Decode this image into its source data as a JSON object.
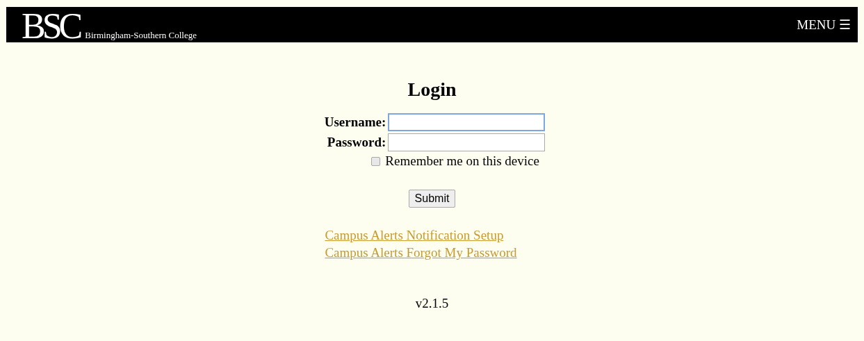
{
  "header": {
    "logo_mark": "BSC",
    "logo_text": "Birmingham-Southern College",
    "menu": {
      "label": "MENU",
      "icon": "☰"
    }
  },
  "login": {
    "title": "Login",
    "fields": [
      {
        "label": "Username:",
        "focused": true
      },
      {
        "label": "Password:",
        "focused": false
      }
    ],
    "remember": {
      "label": "Remember me on this device",
      "checked": false
    },
    "submit": "Submit"
  },
  "links": [
    "Campus Alerts Notification Setup",
    "Campus Alerts Forgot My Password"
  ],
  "version": "v2.1.5"
}
